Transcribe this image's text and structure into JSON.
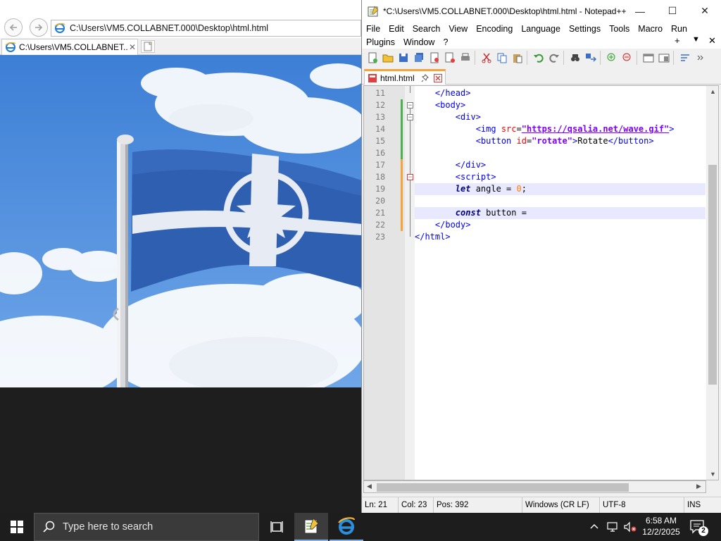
{
  "ie": {
    "address": "C:\\Users\\VM5.COLLABNET.000\\Desktop\\html.html",
    "tab_label": "C:\\Users\\VM5.COLLABNET....",
    "tab_close": "✕",
    "back_icon": "back-arrow-icon",
    "forward_icon": "forward-arrow-icon",
    "page_image": "waving-flag-image"
  },
  "npp": {
    "title": "*C:\\Users\\VM5.COLLABNET.000\\Desktop\\html.html - Notepad++",
    "window_controls": {
      "minimize": "—",
      "maximize": "☐",
      "close": "✕"
    },
    "menu_row_1": [
      "File",
      "Edit",
      "Search",
      "View",
      "Encoding",
      "Language",
      "Settings",
      "Tools",
      "Macro",
      "Run"
    ],
    "menu_row_2": [
      "Plugins",
      "Window",
      "?"
    ],
    "menu_extras": {
      "plus": "+",
      "down": "▼",
      "close": "✕"
    },
    "tab_label": "html.html",
    "line_numbers": [
      "11",
      "12",
      "13",
      "14",
      "15",
      "16",
      "17",
      "18",
      "19",
      "20",
      "21",
      "22",
      "23"
    ],
    "code": {
      "l11": "</head>",
      "l12": "<body>",
      "l13": "<div>",
      "l14_tag": "<img ",
      "l14_attr": "src",
      "l14_eq": "=",
      "l14_url": "\"https://qsalia.net/wave.gif\"",
      "l14_end": ">",
      "l15_tag": "<button ",
      "l15_attr": "id",
      "l15_eq": "=",
      "l15_val": "\"rotate\"",
      "l15_close1": ">",
      "l15_text": "Rotate",
      "l15_close2": "</button>",
      "l17": "</div>",
      "l18": "<script>",
      "l19_kw": "let",
      "l19_mid": " angle = ",
      "l19_num": "0",
      "l19_end": ";",
      "l21_kw": "const",
      "l21_rest": " button =",
      "l22": "</body>",
      "l23": "</html>"
    },
    "status": {
      "line": "Ln: 21",
      "col": "Col: 23",
      "pos": "Pos: 392",
      "eol": "Windows (CR LF)",
      "encoding": "UTF-8",
      "mode": "INS"
    }
  },
  "taskbar": {
    "search_placeholder": "Type here to search",
    "time": "6:58 AM",
    "date": "12/2/2025",
    "notifications": "2",
    "accent": "#7fb0e6"
  }
}
